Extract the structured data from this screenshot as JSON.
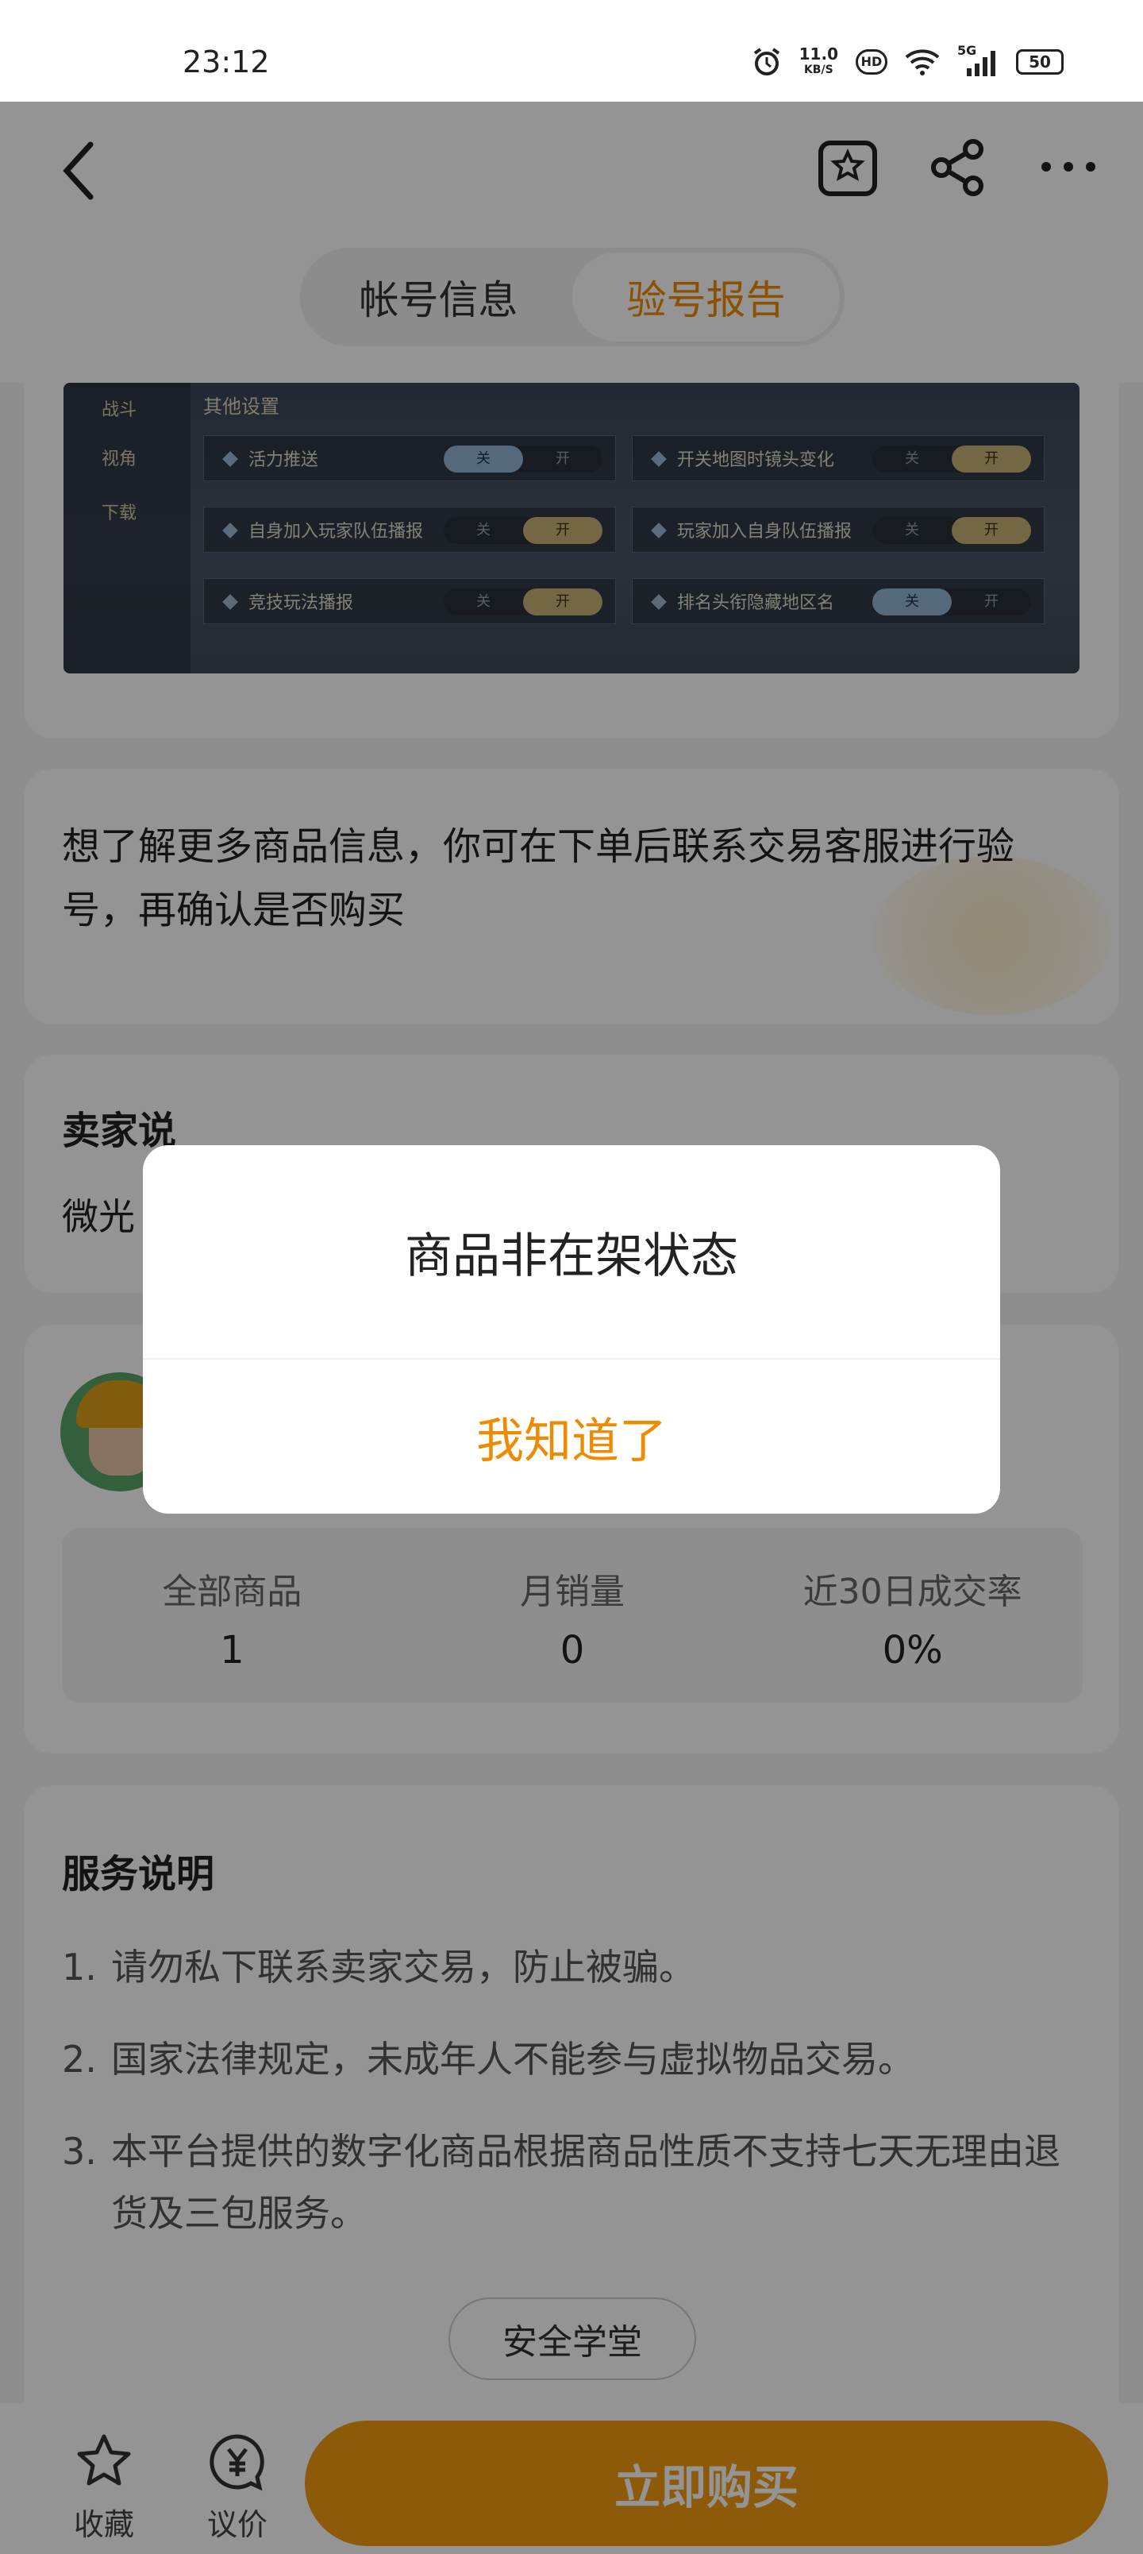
{
  "status_bar": {
    "time": "23:12",
    "net_speed_value": "11.0",
    "net_speed_unit": "KB/S",
    "hd": "HD",
    "signal": "5G",
    "battery": "50"
  },
  "nav": {
    "tabs": [
      {
        "label": "帐号信息",
        "active": false
      },
      {
        "label": "验号报告",
        "active": true
      }
    ]
  },
  "screenshot": {
    "side_items": [
      "战斗",
      "视角",
      "下载"
    ],
    "title": "其他设置",
    "settings": [
      {
        "label": "活力推送",
        "off": "关",
        "on": "开",
        "value": "关"
      },
      {
        "label": "开关地图时镜头变化",
        "off": "关",
        "on": "开",
        "value": "开"
      },
      {
        "label": "自身加入玩家队伍播报",
        "off": "关",
        "on": "开",
        "value": "开"
      },
      {
        "label": "玩家加入自身队伍播报",
        "off": "关",
        "on": "开",
        "value": "开"
      },
      {
        "label": "竞技玩法播报",
        "off": "关",
        "on": "开",
        "value": "开"
      },
      {
        "label": "排名头衔隐藏地区名",
        "off": "关",
        "on": "开",
        "value": "关"
      }
    ]
  },
  "info": {
    "text": "想了解更多商品信息，你可在下单后联系交易客服进行验号，再确认是否购买"
  },
  "seller": {
    "title": "卖家说",
    "text": "微光"
  },
  "stats": [
    {
      "label": "全部商品",
      "value": "1"
    },
    {
      "label": "月销量",
      "value": "0"
    },
    {
      "label": "近30日成交率",
      "value": "0%"
    }
  ],
  "service": {
    "title": "服务说明",
    "items": [
      {
        "num": "1.",
        "text": "请勿私下联系卖家交易，防止被骗。"
      },
      {
        "num": "2.",
        "text": "国家法律规定，未成年人不能参与虚拟物品交易。"
      },
      {
        "num": "3.",
        "text": "本平台提供的数字化商品根据商品性质不支持七天无理由退货及三包服务。"
      }
    ],
    "school_button": "安全学堂"
  },
  "bottom_bar": {
    "collect_label": "收藏",
    "bargain_label": "议价",
    "buy_label": "立即购买"
  },
  "dialog": {
    "message": "商品非在架状态",
    "confirm_label": "我知道了"
  },
  "colors": {
    "accent": "#f08a00",
    "buy_button": "#f39c12",
    "overlay": "rgba(0,0,0,0.42)"
  }
}
